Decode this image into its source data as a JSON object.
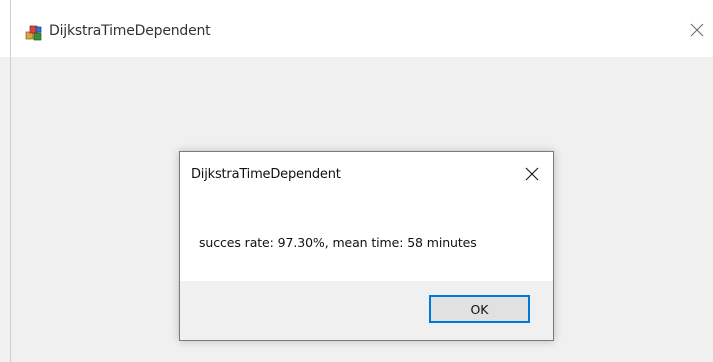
{
  "window": {
    "title": "DijkstraTimeDependent",
    "close_icon": "close-icon",
    "app_icon": "app-icon"
  },
  "dialog": {
    "title": "DijkstraTimeDependent",
    "message": "succes rate: 97.30%, mean time: 58 minutes",
    "ok_label": "OK",
    "close_icon": "close-icon"
  },
  "colors": {
    "titlebar_bg": "#ffffff",
    "client_bg": "#f0f0f0",
    "button_border": "#0078d7",
    "button_bg": "#e1e1e1"
  }
}
